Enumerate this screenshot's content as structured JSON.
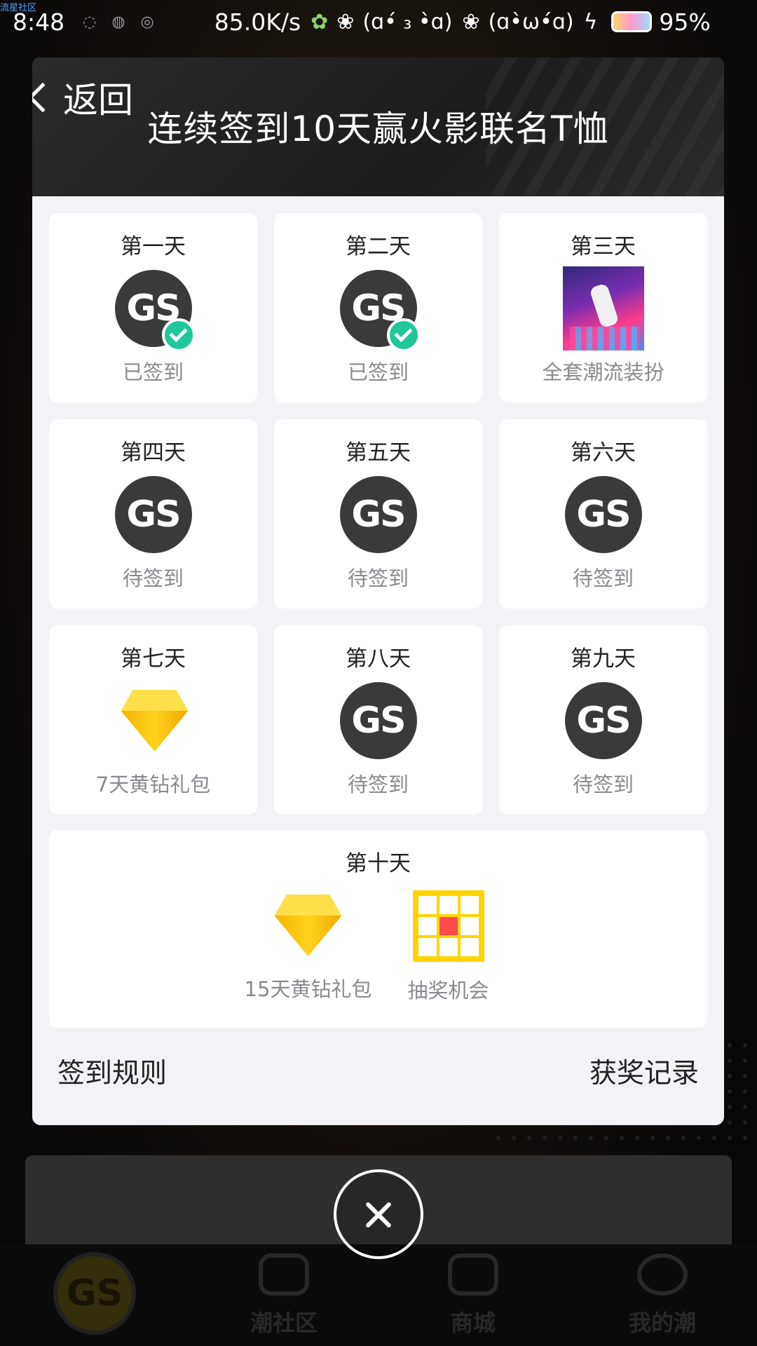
{
  "status_bar": {
    "time": "8:48",
    "speed": "85.0K/s",
    "kaomoji_1": "(ɑ•́ ₃ •̀ɑ)",
    "kaomoji_2": "(ɑ•̀ω•́ɑ)",
    "battery": "95%",
    "corner_tag": "流星社区"
  },
  "modal": {
    "back_label": "返回",
    "title": "连续签到10天赢火影联名T恤",
    "days": [
      {
        "day": "第一天",
        "icon": "gs-coin-icon",
        "checked": true,
        "label": "已签到"
      },
      {
        "day": "第二天",
        "icon": "gs-coin-icon",
        "checked": true,
        "label": "已签到"
      },
      {
        "day": "第三天",
        "icon": "outfit-image",
        "checked": false,
        "label": "全套潮流装扮"
      },
      {
        "day": "第四天",
        "icon": "gs-coin-icon",
        "checked": false,
        "label": "待签到"
      },
      {
        "day": "第五天",
        "icon": "gs-coin-icon",
        "checked": false,
        "label": "待签到"
      },
      {
        "day": "第六天",
        "icon": "gs-coin-icon",
        "checked": false,
        "label": "待签到"
      },
      {
        "day": "第七天",
        "icon": "yellow-diamond-icon",
        "checked": false,
        "label": "7天黄钻礼包"
      },
      {
        "day": "第八天",
        "icon": "gs-coin-icon",
        "checked": false,
        "label": "待签到"
      },
      {
        "day": "第九天",
        "icon": "gs-coin-icon",
        "checked": false,
        "label": "待签到"
      }
    ],
    "day_ten": {
      "day": "第十天",
      "rewards": [
        {
          "icon": "yellow-diamond-icon",
          "label": "15天黄钻礼包"
        },
        {
          "icon": "lottery-grid-icon",
          "label": "抽奖机会"
        }
      ]
    },
    "coin_text": "GS",
    "rules_link": "签到规则",
    "records_link": "获奖记录"
  },
  "background": {
    "nav": [
      {
        "label": "",
        "icon": "gs-home-icon"
      },
      {
        "label": "潮社区",
        "icon": "chat-bubble-icon"
      },
      {
        "label": "商城",
        "icon": "shopping-bag-icon"
      },
      {
        "label": "我的潮",
        "icon": "profile-icon"
      }
    ]
  },
  "colors": {
    "header_bg": "#1f1f1f",
    "check_green": "#1fc79a",
    "label_gray": "#8a8a8f",
    "diamond_yellow": "#ffd21f"
  }
}
